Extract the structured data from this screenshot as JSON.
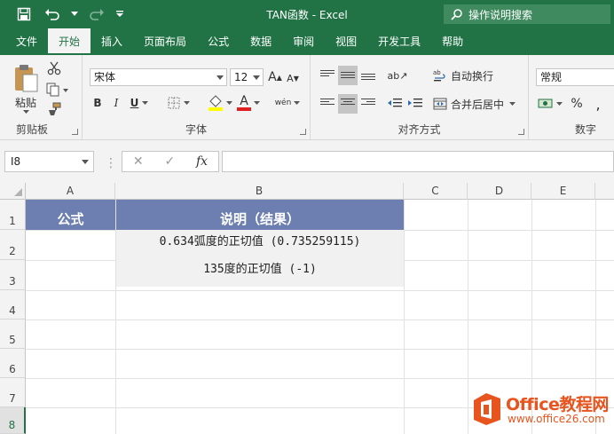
{
  "titlebar": {
    "title": "TAN函数  -  Excel",
    "tell_me": "操作说明搜索"
  },
  "tabs": [
    {
      "label": "文件",
      "active": false
    },
    {
      "label": "开始",
      "active": true
    },
    {
      "label": "插入",
      "active": false
    },
    {
      "label": "页面布局",
      "active": false
    },
    {
      "label": "公式",
      "active": false
    },
    {
      "label": "数据",
      "active": false
    },
    {
      "label": "审阅",
      "active": false
    },
    {
      "label": "视图",
      "active": false
    },
    {
      "label": "开发工具",
      "active": false
    },
    {
      "label": "帮助",
      "active": false
    }
  ],
  "ribbon": {
    "clipboard": {
      "paste_label": "粘贴",
      "group_label": "剪贴板"
    },
    "font": {
      "font_name": "宋体",
      "font_size": "12",
      "group_label": "字体",
      "bold": "B",
      "italic": "I",
      "underline": "U",
      "font_color_glyph": "A",
      "phonetic_glyph": "wén",
      "grow_glyph": "A",
      "shrink_glyph": "A"
    },
    "alignment": {
      "wrap_text": "自动换行",
      "merge_center": "合并后居中",
      "group_label": "对齐方式"
    },
    "number": {
      "format": "常规",
      "group_label": "数字",
      "percent": "%"
    }
  },
  "formula_bar": {
    "name_box": "I8",
    "fx": "fx",
    "formula": ""
  },
  "columns": [
    "A",
    "B",
    "C",
    "D",
    "E"
  ],
  "rows": [
    "1",
    "2",
    "3",
    "4",
    "5",
    "6",
    "7",
    "8"
  ],
  "cells": {
    "A1": "公式",
    "B1": "说明（结果）",
    "B2": "0.634弧度的正切值 (0.735259115)",
    "B3": "135度的正切值 (-1)"
  },
  "watermark": {
    "brand": "Office教程网",
    "url": "www.office26.com"
  },
  "colors": {
    "excel_green": "#217346",
    "header_fill": "#6d7fb0",
    "watermark_orange": "#e8541e"
  }
}
